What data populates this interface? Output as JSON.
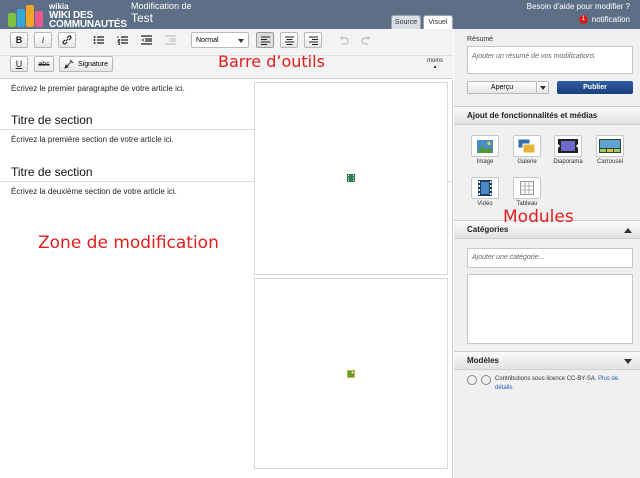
{
  "header": {
    "logo_small": "wikia",
    "logo_line1": "WIKI DES",
    "logo_line2": "COMMUNAUTÉS",
    "edit_label": "Modification de",
    "page_title": "Test",
    "help_link": "Besoin d'aide pour modifier ?",
    "notification_count": "1",
    "notification_label": "notification",
    "tabs": [
      {
        "label": "Source",
        "active": false
      },
      {
        "label": "Visuel",
        "active": true
      }
    ]
  },
  "toolbar": {
    "bold": "B",
    "italic": "i",
    "format_select": "Normal",
    "underline": "U",
    "strike": "abc",
    "signature": "Signature",
    "moins": "moins",
    "icons": [
      "link-icon",
      "bullet-list-icon",
      "numbered-list-icon",
      "outdent-icon",
      "indent-icon",
      "align-left-icon",
      "align-center-icon",
      "align-right-icon",
      "undo-icon",
      "redo-icon",
      "signature-icon"
    ]
  },
  "annotations": {
    "toolbar": "Barre d’outils",
    "zone": "Zone de modification",
    "modules": "Modules"
  },
  "editor": {
    "first_paragraph": "Écrivez le premier paragraphe de votre article ici.",
    "section1_title": "Titre de section",
    "section1_text": "Écrivez la première section de votre article ici.",
    "section2_title": "Titre de section",
    "section2_text": "Écrivez la deuxième section de votre article ici."
  },
  "rail": {
    "summary_label": "Résumé",
    "summary_placeholder": "Ajouter un résumé de vos modifications",
    "preview_button": "Aperçu",
    "publish_button": "Publier",
    "features_title": "Ajout de fonctionnalités et médias",
    "features": [
      {
        "label": "Image",
        "icon": "image-icon"
      },
      {
        "label": "Galerie",
        "icon": "gallery-icon"
      },
      {
        "label": "Diaporama",
        "icon": "slideshow-icon"
      },
      {
        "label": "Carrousel",
        "icon": "slider-icon"
      },
      {
        "label": "Vidéo",
        "icon": "video-icon"
      },
      {
        "label": "Tableau",
        "icon": "table-icon"
      }
    ],
    "categories_title": "Catégories",
    "category_placeholder": "Ajouter une catégorie...",
    "templates_title": "Modèles",
    "license_text": "Contributions sous licence CC-BY-SA.",
    "license_more": "Plus de détails."
  },
  "colors": {
    "header_bg": "#5d6f87",
    "annotation": "#e41c1c",
    "publish": "#1b3f7a"
  }
}
